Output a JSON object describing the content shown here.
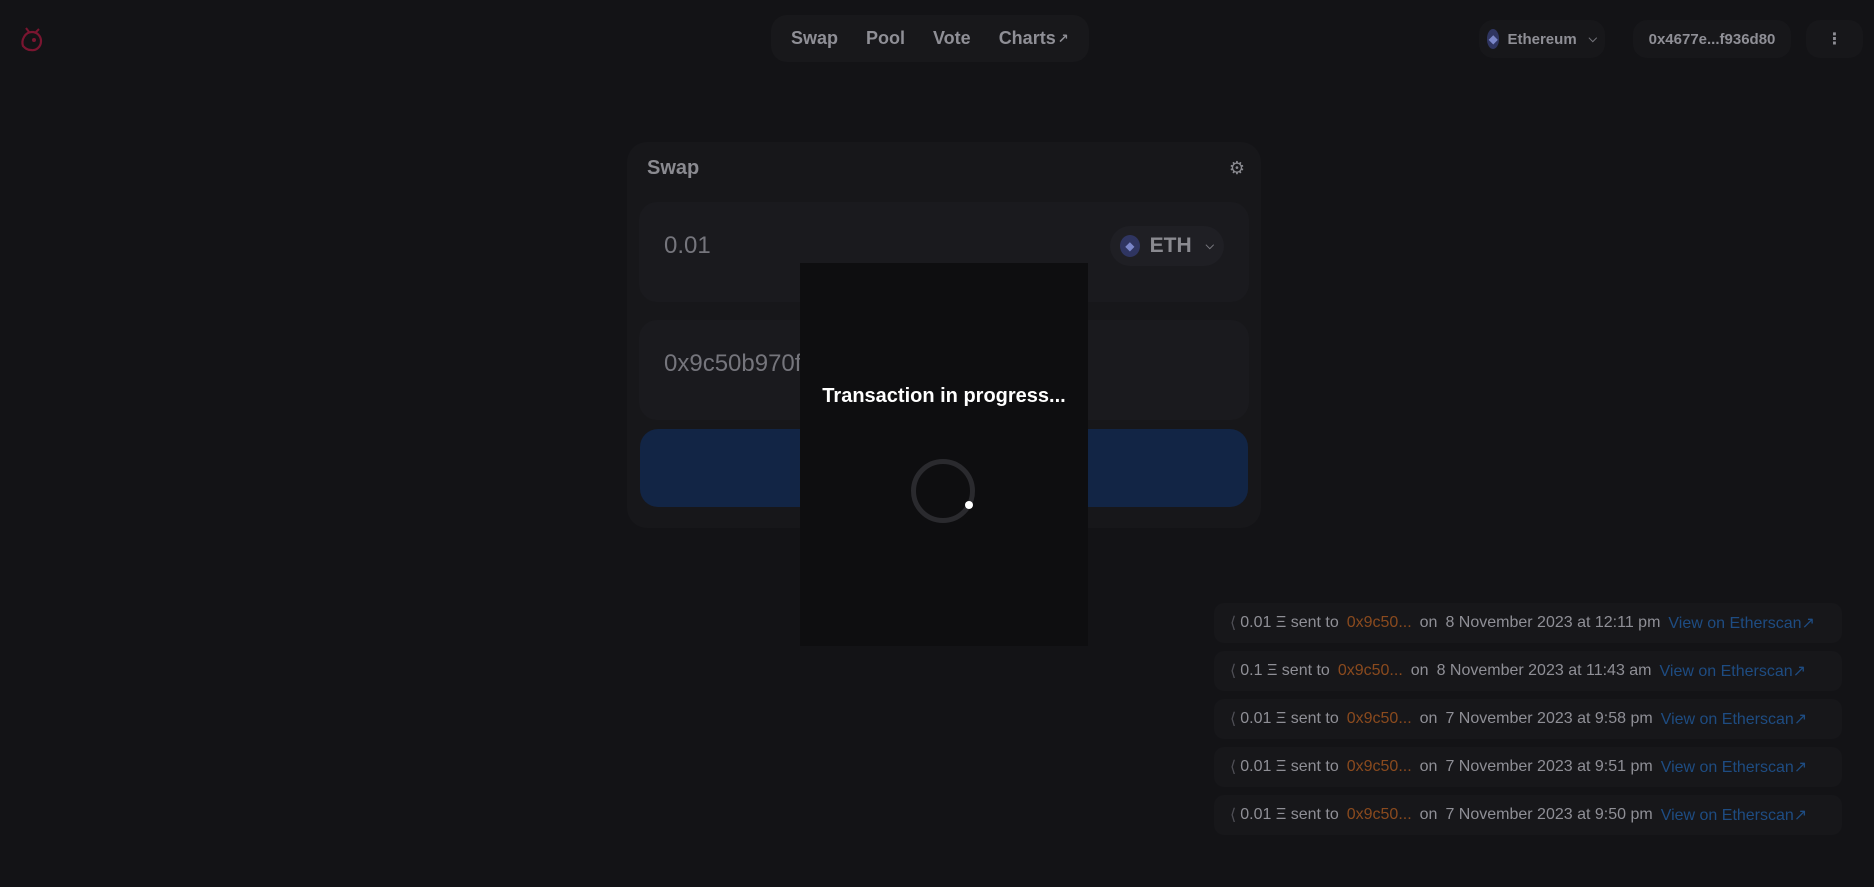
{
  "nav": {
    "items": [
      {
        "label": "Swap"
      },
      {
        "label": "Pool"
      },
      {
        "label": "Vote"
      },
      {
        "label": "Charts",
        "external": "↗"
      }
    ]
  },
  "network": {
    "label": "Ethereum",
    "icon": "ethereum-icon"
  },
  "account": {
    "address": "0x4677e...f936d80"
  },
  "more": {
    "label": "⋮"
  },
  "swap_card": {
    "title": "Swap",
    "amount": "0.01",
    "token": "ETH",
    "recipient": "0x9c50b970f02"
  },
  "modal": {
    "title": "Transaction in progress..."
  },
  "transactions": [
    {
      "amount": "0.01 Ξ",
      "sent_to_label": "sent to",
      "address": "0x9c50...",
      "on_label": "on",
      "date": "8 November 2023 at 12:11 pm",
      "link": "View on Etherscan↗"
    },
    {
      "amount": "0.1 Ξ",
      "sent_to_label": "sent to",
      "address": "0x9c50...",
      "on_label": "on",
      "date": "8 November 2023 at 11:43 am",
      "link": "View on Etherscan↗"
    },
    {
      "amount": "0.01 Ξ",
      "sent_to_label": "sent to",
      "address": "0x9c50...",
      "on_label": "on",
      "date": "7 November 2023 at 9:58 pm",
      "link": "View on Etherscan↗"
    },
    {
      "amount": "0.01 Ξ",
      "sent_to_label": "sent to",
      "address": "0x9c50...",
      "on_label": "on",
      "date": "7 November 2023 at 9:51 pm",
      "link": "View on Etherscan↗"
    },
    {
      "amount": "0.01 Ξ",
      "sent_to_label": "sent to",
      "address": "0x9c50...",
      "on_label": "on",
      "date": "7 November 2023 at 9:50 pm",
      "link": "View on Etherscan↗"
    }
  ],
  "colors": {
    "background": "#131316",
    "accent_link": "#1e4c82",
    "address": "#8a4a1e"
  }
}
